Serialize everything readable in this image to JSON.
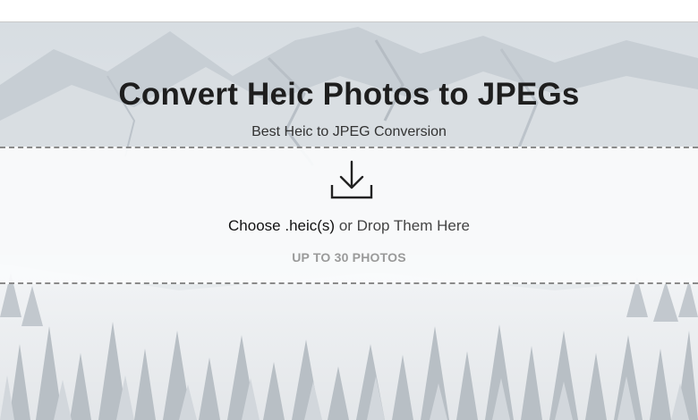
{
  "hero": {
    "title": "Convert Heic Photos to JPEGs",
    "subtitle": "Best Heic to JPEG Conversion",
    "background": "snowy-forest-mountain-photo"
  },
  "dropzone": {
    "choose_link": "Choose .heic(s)",
    "drop_text": " or Drop Them Here",
    "limit_note": "UP TO 30 PHOTOS",
    "icon": "download-icon"
  },
  "colors": {
    "title": "#1e1e1e",
    "border_dash": "#8a8a8a",
    "limit_note": "#9a9a9a"
  }
}
